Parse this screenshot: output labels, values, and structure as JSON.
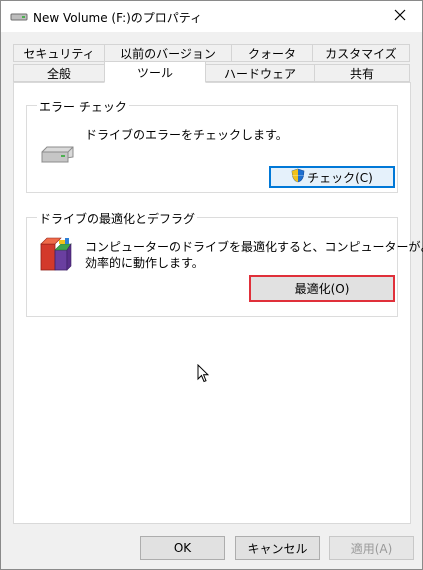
{
  "window": {
    "title": "New Volume (F:)のプロパティ",
    "title_icon": "drive-icon",
    "close_icon": "close-icon"
  },
  "tabs": {
    "row1": [
      "セキュリティ",
      "以前のバージョン",
      "クォータ",
      "カスタマイズ"
    ],
    "row2": [
      "全般",
      "ツール",
      "ハードウェア",
      "共有"
    ],
    "active": "ツール"
  },
  "error_check": {
    "group_label": "エラー チェック",
    "description": "ドライブのエラーをチェックします。",
    "button_label": "チェック(C)",
    "icon": "hard-drive-icon",
    "button_icon": "uac-shield-icon"
  },
  "optimize": {
    "group_label": "ドライブの最適化とデフラグ",
    "description_line1": "コンピューターのドライブを最適化すると、コンピューターがより",
    "description_line2": "効率的に動作します。",
    "button_label": "最適化(O)",
    "icon": "defrag-icon"
  },
  "footer": {
    "ok_label": "OK",
    "cancel_label": "キャンセル",
    "apply_label": "適用(A)"
  },
  "colors": {
    "focus_border": "#0078d7",
    "highlight_border": "#e0303a",
    "dialog_bg": "#f0f0f0"
  }
}
